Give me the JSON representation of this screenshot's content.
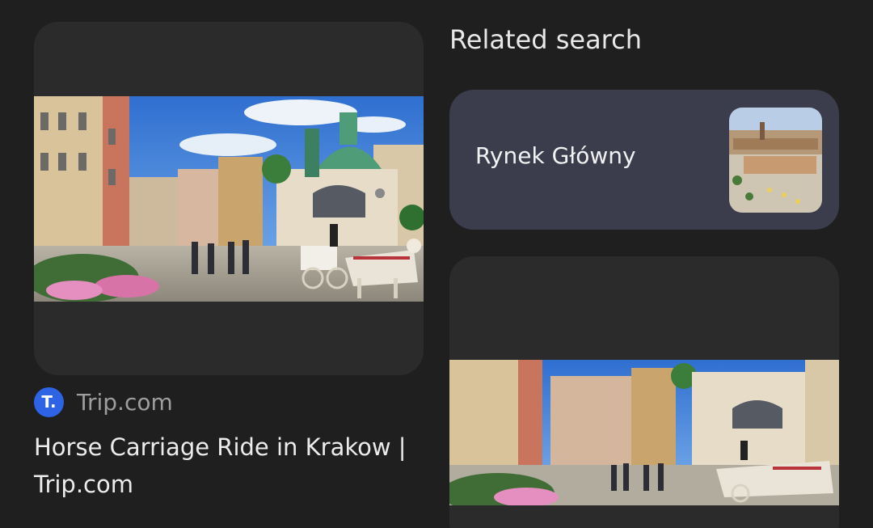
{
  "result": {
    "image_alt": "Horse carriages on Krakow main square",
    "source_letter": "T.",
    "source_name": "Trip.com",
    "title": "Horse Carriage Ride in Krakow | Trip.com",
    "favicon_color": "#2f63e6"
  },
  "related": {
    "heading": "Related search",
    "items": [
      {
        "label": "Rynek Główny"
      }
    ]
  },
  "colors": {
    "background": "#1f1f1f",
    "card": "#2b2b2b",
    "chip": "#3b3d4d"
  }
}
